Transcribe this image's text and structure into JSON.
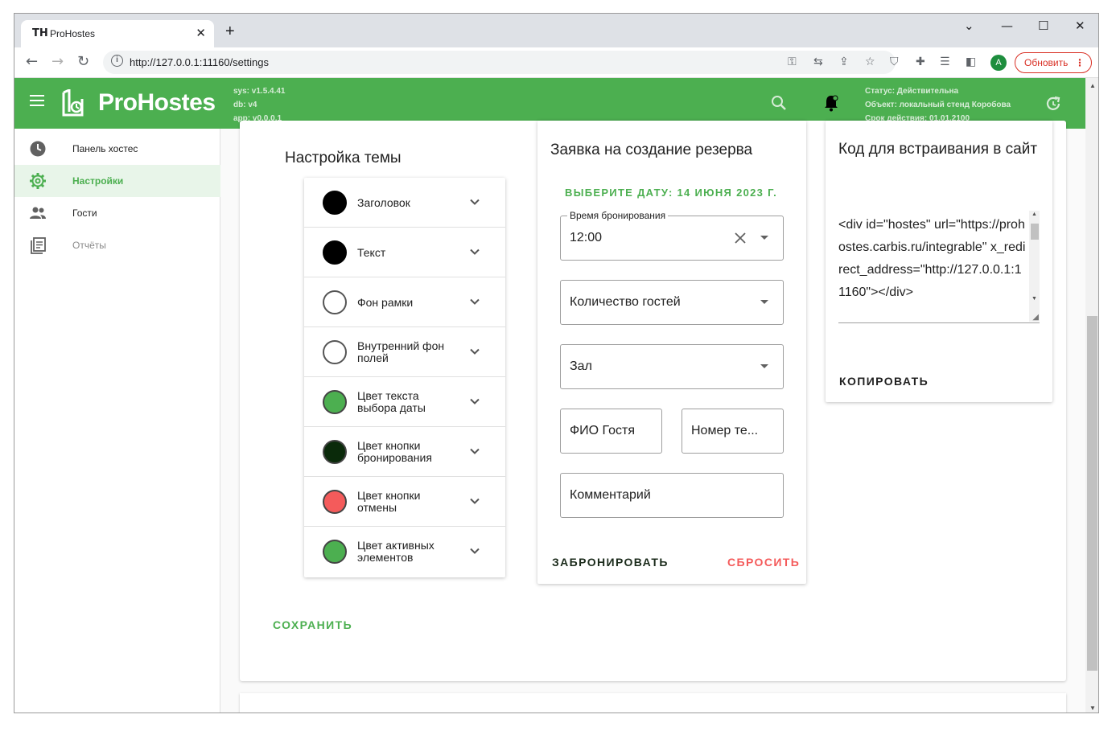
{
  "browser": {
    "tab_title": "ProHostes",
    "tab_favicon": "TH",
    "url": "http://127.0.0.1:11160/settings",
    "avatar_letter": "A",
    "update_label": "Обновить",
    "minimize": "—",
    "maximize": "☐",
    "close": "✕",
    "chevron": "⌄"
  },
  "appbar": {
    "brand": "ProHostes",
    "versions": [
      "sys: v1.5.4.41",
      "db: v4",
      "app: v0.0.0.1"
    ],
    "status_lines": [
      "Статус: Действительна",
      "Объект: локальный стенд Коробова",
      "Срок действия: 01.01.2100"
    ],
    "color": "#4caf50"
  },
  "sidebar": {
    "items": [
      {
        "label": "Панель хостес",
        "icon": "clock-icon"
      },
      {
        "label": "Настройки",
        "icon": "gear-icon",
        "active": true
      },
      {
        "label": "Гости",
        "icon": "people-icon"
      },
      {
        "label": "Отчёты",
        "icon": "report-icon"
      }
    ]
  },
  "theme": {
    "title": "Настройка темы",
    "items": [
      {
        "label": "Заголовок",
        "color": "#000000"
      },
      {
        "label": "Текст",
        "color": "#000000"
      },
      {
        "label": "Фон рамки",
        "color": "#ffffff"
      },
      {
        "label": "Внутренний фон полей",
        "color": "#ffffff"
      },
      {
        "label": "Цвет текста выбора даты",
        "color": "#4caf50"
      },
      {
        "label": "Цвет кнопки бронирования",
        "color": "#0a2a0a"
      },
      {
        "label": "Цвет кнопки отмены",
        "color": "#f45b5b"
      },
      {
        "label": "Цвет активных элементов",
        "color": "#4caf50"
      }
    ],
    "save_label": "СОХРАНИТЬ"
  },
  "booking": {
    "title": "Заявка на создание резерва",
    "pick_date": "ВЫБЕРИТЕ ДАТУ: 14 ИЮНЯ 2023 Г.",
    "time_legend": "Время бронирования",
    "time_value": "12:00",
    "guests_placeholder": "Количество гостей",
    "hall_placeholder": "Зал",
    "name_placeholder": "ФИО Гостя",
    "phone_placeholder": "Номер те...",
    "comment_placeholder": "Комментарий",
    "book_label": "ЗАБРОНИРОВАТЬ",
    "reset_label": "СБРОСИТЬ",
    "reset_color": "#f45b5b"
  },
  "embed": {
    "title": "Код для встраивания в сайт",
    "code": "<div id=\"hostes\" url=\"https://prohostes.carbis.ru/integrable\" x_redirect_address=\"http://127.0.0.1:11160\"></div>",
    "copy_label": "КОПИРОВАТЬ"
  }
}
